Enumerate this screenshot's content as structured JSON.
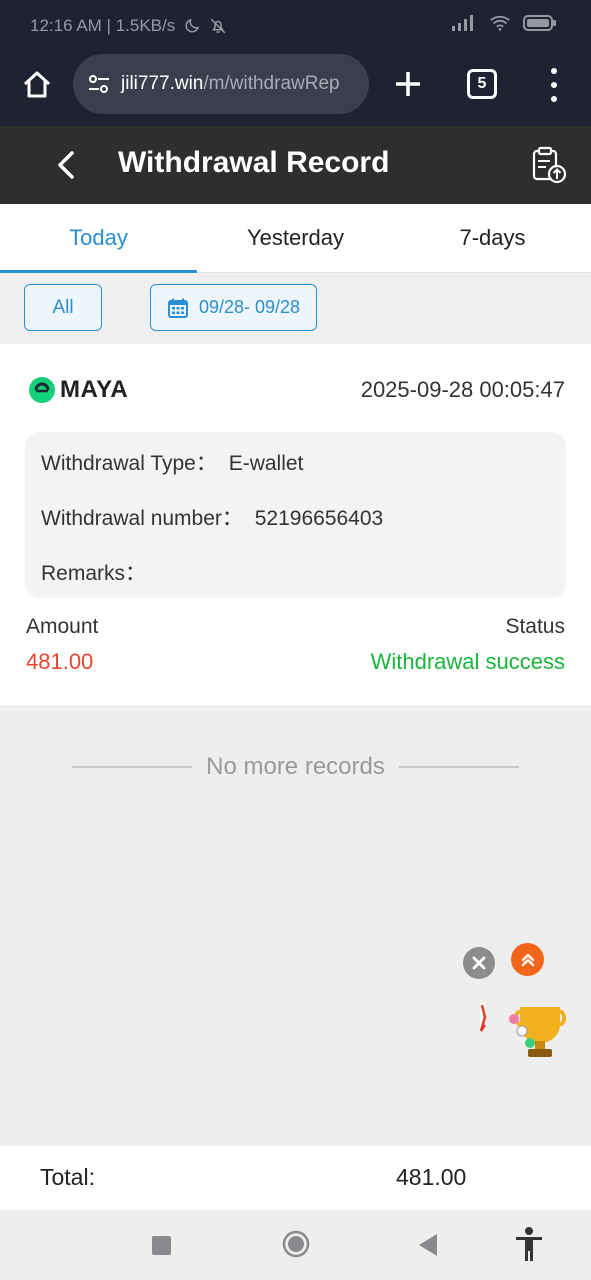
{
  "status_bar": {
    "time_speed": "12:16 AM | 1.5KB/s"
  },
  "browser": {
    "url_host": "jili777.win",
    "url_path": "/m/withdrawRep",
    "tab_count": "5"
  },
  "header": {
    "title": "Withdrawal Record"
  },
  "tabs": [
    {
      "label": "Today",
      "active": true
    },
    {
      "label": "Yesterday",
      "active": false
    },
    {
      "label": "7-days",
      "active": false
    }
  ],
  "filters": {
    "all_label": "All",
    "date_range": "09/28- 09/28"
  },
  "record": {
    "brand": "MAYA",
    "datetime": "2025-09-28 00:05:47",
    "type_label": "Withdrawal Type：",
    "type_value": "E-wallet",
    "number_label": "Withdrawal number：",
    "number_value": "52196656403",
    "remarks_label": "Remarks：",
    "remarks_value": "",
    "amount_label": "Amount",
    "amount_value": "481.00",
    "status_label": "Status",
    "status_value": "Withdrawal success"
  },
  "list_footer": "No more records",
  "total": {
    "label": "Total:",
    "value": "481.00"
  },
  "colors": {
    "accent": "#2a8fd0",
    "amount": "#e8442e",
    "success": "#19b53a",
    "header_bg": "#2e2e2e",
    "browser_bg": "#1f2230"
  },
  "icons": [
    "home-icon",
    "site-settings-icon",
    "plus-icon",
    "tabs-icon",
    "more-icon",
    "back-arrow-icon",
    "clipboard-upload-icon",
    "calendar-icon",
    "maya-logo-icon",
    "close-icon",
    "scroll-up-icon",
    "trophy-icon"
  ]
}
